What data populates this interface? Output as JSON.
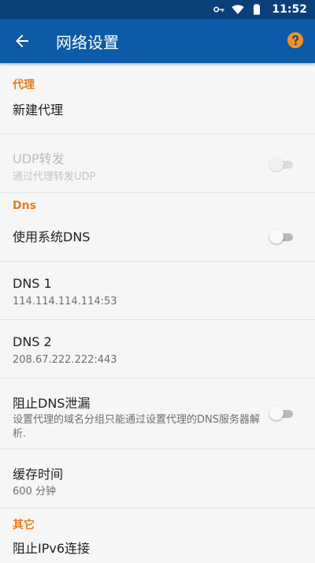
{
  "status_bar": {
    "time": "11:52"
  },
  "app_bar": {
    "title": "网络设置"
  },
  "sections": {
    "proxy": {
      "header": "代理",
      "new_proxy": {
        "title": "新建代理"
      },
      "udp_forward": {
        "title": "UDP转发",
        "summary": "通过代理转发UDP",
        "enabled": false,
        "checked": false
      }
    },
    "dns": {
      "header": "Dns",
      "use_system_dns": {
        "title": "使用系统DNS",
        "checked": false
      },
      "dns1": {
        "title": "DNS 1",
        "summary": "114.114.114.114:53"
      },
      "dns2": {
        "title": "DNS 2",
        "summary": "208.67.222.222:443"
      },
      "block_dns_leak": {
        "title": "阻止DNS泄漏",
        "summary": "设置代理的域名分组只能通过设置代理的DNS服务器解析.",
        "checked": false
      },
      "cache_time": {
        "title": "缓存时间",
        "summary": "600 分钟"
      }
    },
    "other": {
      "header": "其它",
      "block_ipv6": {
        "title": "阻止IPv6连接"
      }
    }
  },
  "colors": {
    "status_bar": "#0a3f78",
    "app_bar": "#0d5ba8",
    "accent": "#e87d1e"
  }
}
